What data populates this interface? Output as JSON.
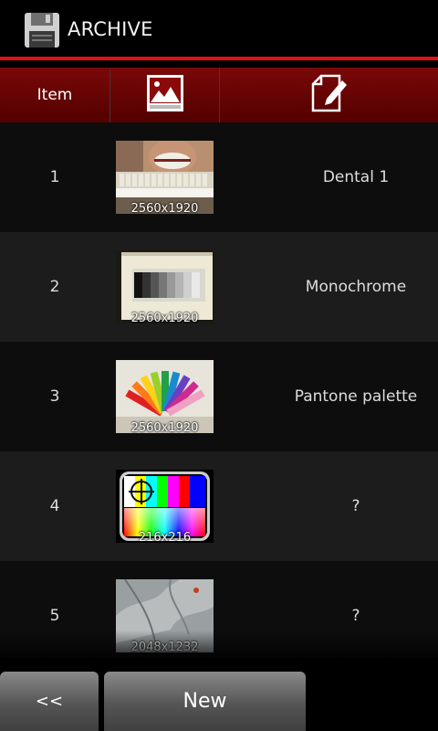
{
  "titlebar": {
    "title": "ARCHIVE",
    "icon": "floppy-disk-icon"
  },
  "header": {
    "item_label": "Item",
    "image_icon": "image-icon",
    "name_icon": "edit-note-icon"
  },
  "rows": [
    {
      "item": "1",
      "resolution": "2560x1920",
      "name": "Dental 1"
    },
    {
      "item": "2",
      "resolution": "2560x1920",
      "name": "Monochrome"
    },
    {
      "item": "3",
      "resolution": "2560x1920",
      "name": "Pantone palette"
    },
    {
      "item": "4",
      "resolution": "216x216",
      "name": "?"
    },
    {
      "item": "5",
      "resolution": "2048x1232",
      "name": "?"
    }
  ],
  "buttons": {
    "back_label": "<<",
    "new_label": "New"
  },
  "colors": {
    "accent_red": "#e01010",
    "header_bg": "#6a0404"
  }
}
